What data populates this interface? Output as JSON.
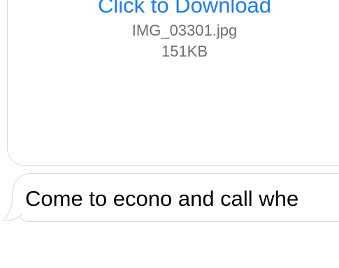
{
  "attachment": {
    "link_label": "Click to Download",
    "file_name": "IMG_03301.jpg",
    "file_size": "151KB"
  },
  "message": {
    "text": "Come to econo and call whe"
  },
  "colors": {
    "link": "#1a7cf5",
    "meta_text": "#6e6e73",
    "bubble_border": "#d9d9de"
  },
  "icons": {
    "tail": "bubble-tail-icon"
  }
}
